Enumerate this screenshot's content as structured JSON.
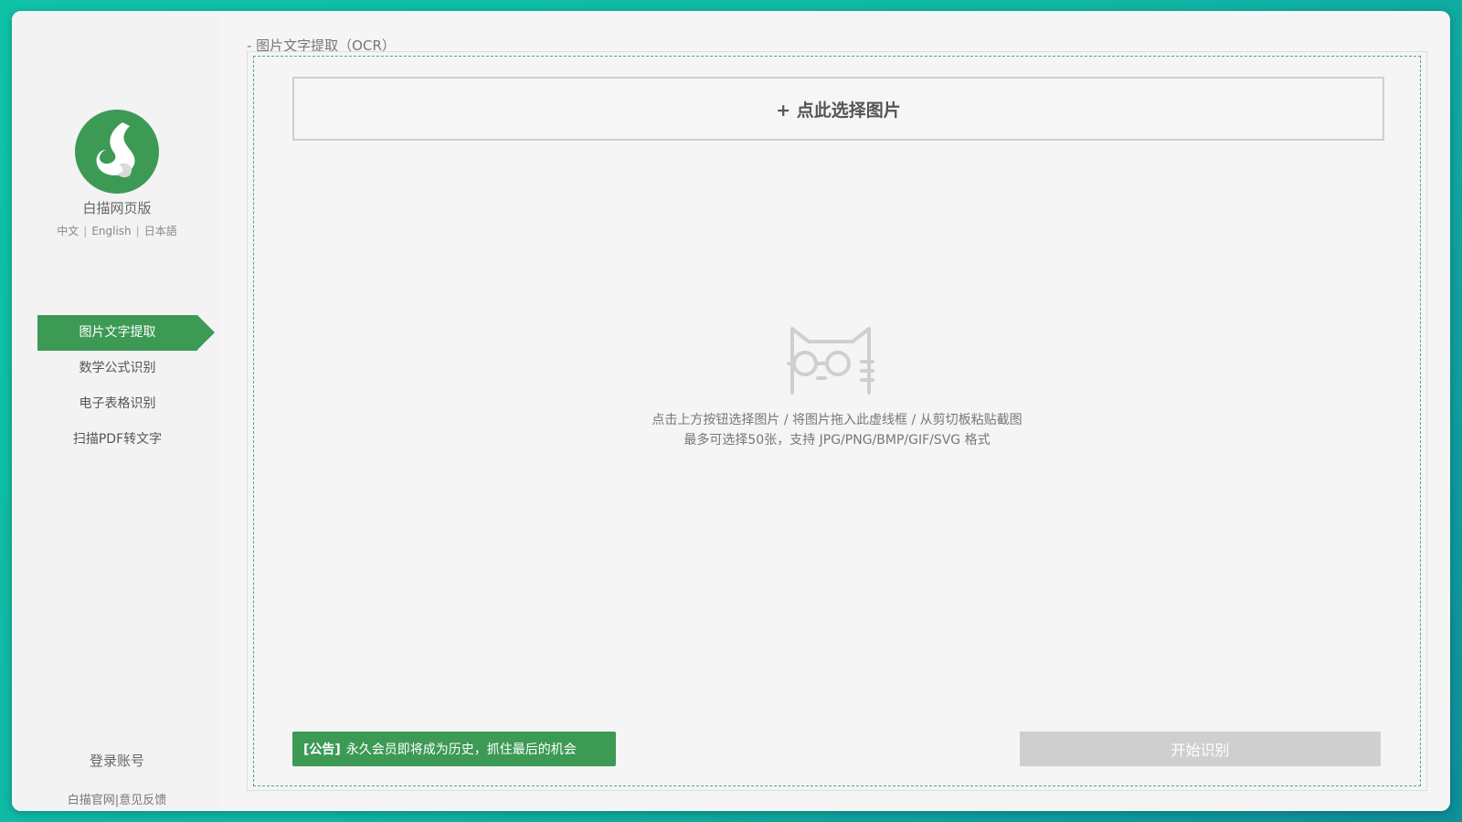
{
  "app": {
    "name": "白描网页版",
    "languages": [
      "中文",
      "English",
      "日本語"
    ],
    "colors": {
      "accent": "#3d9a55",
      "background": "#f5f5f5"
    }
  },
  "sidebar": {
    "items": [
      {
        "label": "图片文字提取",
        "active": true
      },
      {
        "label": "数学公式识别",
        "active": false
      },
      {
        "label": "电子表格识别",
        "active": false
      },
      {
        "label": "扫描PDF转文字",
        "active": false
      }
    ],
    "login_label": "登录账号",
    "footer": {
      "site": "白描官网",
      "separator": "|",
      "feedback": "意见反馈"
    }
  },
  "main": {
    "title": "- 图片文字提取（OCR）",
    "select_label": "+ 点此选择图片",
    "hint_line1": "点击上方按钮选择图片 / 将图片拖入此虚线框 / 从剪切板粘贴截图",
    "hint_line2": "最多可选择50张，支持 JPG/PNG/BMP/GIF/SVG 格式",
    "notice": {
      "tag": "[公告]",
      "text": "永久会员即将成为历史，抓住最后的机会"
    },
    "start_label": "开始识别",
    "icons": {
      "logo": "baimiao-logo-icon",
      "placeholder": "cat-glasses-icon"
    }
  }
}
